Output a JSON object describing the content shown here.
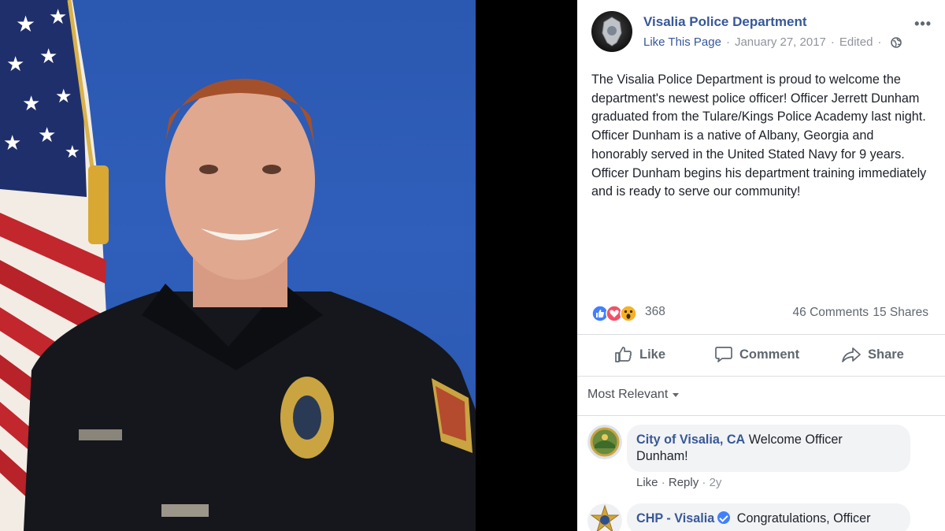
{
  "post": {
    "page_name": "Visalia Police Department",
    "like_page_label": "Like This Page",
    "separator": "·",
    "date": "January 27, 2017",
    "edited_label": "Edited",
    "more_label": "•••",
    "icons": {
      "privacy": "globe-icon",
      "more": "more-icon"
    },
    "text": "The Visalia Police Department is proud to welcome the department's newest police officer! Officer Jerrett Dunham graduated from the Tulare/Kings Police Academy last night. Officer Dunham is a native of Albany, Georgia and honorably served in the United Stated Navy for 9 years. Officer Dunham begins his department training immediately and is ready to serve our community!"
  },
  "stats": {
    "reaction_types": [
      "like",
      "love",
      "wow"
    ],
    "reaction_count": "368",
    "comments": "46 Comments",
    "shares": "15 Shares"
  },
  "actions": {
    "like": "Like",
    "comment": "Comment",
    "share": "Share"
  },
  "comments_section": {
    "sort_label": "Most Relevant",
    "items": [
      {
        "author": "City of Visalia, CA",
        "text_line1": "Welcome Officer",
        "text_line2": "Dunham!",
        "like": "Like",
        "reply": "Reply",
        "age": "2y",
        "verified": false
      },
      {
        "author": "CHP - Visalia",
        "text_line1": "Congratulations, Officer",
        "verified": true
      }
    ]
  },
  "colors": {
    "link_blue": "#365899",
    "backdrop_blue": "#2f5fbb",
    "meta_gray": "#90949c",
    "bubble": "#f2f3f5",
    "like_reaction": "#4080ff",
    "love_reaction": "#f25268",
    "wow_reaction": "#f7b125"
  }
}
